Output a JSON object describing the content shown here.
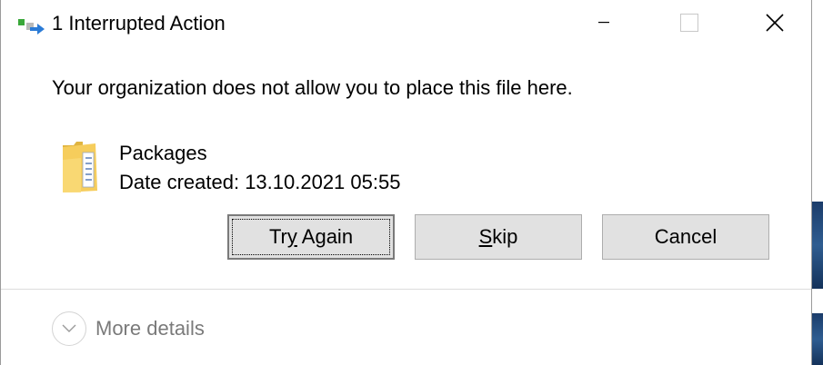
{
  "window": {
    "title": "1 Interrupted Action",
    "title_icon": "file-move-icon"
  },
  "controls": {
    "minimize_icon": "minimize-icon",
    "maximize_icon": "maximize-icon",
    "close_icon": "close-icon"
  },
  "message": "Your organization does not allow you to place this file here.",
  "file": {
    "icon": "folder-icon",
    "name": "Packages",
    "date_created": "Date created: 13.10.2021 05:55"
  },
  "buttons": {
    "try_again_pre": "Tr",
    "try_again_mnemonic": "y",
    "try_again_post": " Again",
    "skip_mnemonic": "S",
    "skip_post": "kip",
    "cancel": "Cancel"
  },
  "details": {
    "label": "More details",
    "icon": "chevron-down-icon"
  },
  "colors": {
    "button_bg": "#e1e1e1",
    "button_border": "#adadad",
    "muted_text": "#7a7a7a"
  }
}
